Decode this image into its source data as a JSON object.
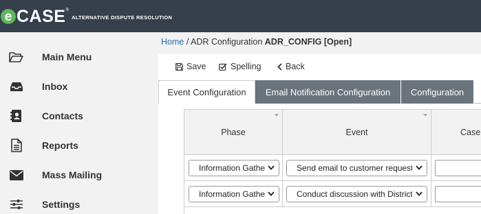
{
  "brand": {
    "logo_e": "e",
    "logo_case": "CASE",
    "logo_reg": "®",
    "tagline": "ALTERNATIVE DISPUTE RESOLUTION"
  },
  "sidebar": {
    "items": [
      {
        "label": "Main Menu",
        "icon": "folder-open-icon"
      },
      {
        "label": "Inbox",
        "icon": "inbox-icon"
      },
      {
        "label": "Contacts",
        "icon": "address-book-icon"
      },
      {
        "label": "Reports",
        "icon": "document-icon"
      },
      {
        "label": "Mass Mailing",
        "icon": "envelope-icon"
      },
      {
        "label": "Settings",
        "icon": "sliders-icon"
      }
    ]
  },
  "breadcrumb": {
    "home": "Home",
    "separator": " / ",
    "current": "ADR Configuration",
    "record": "ADR_CONFIG [Open]"
  },
  "toolbar": {
    "save": "Save",
    "spelling": "Spelling",
    "back": "Back"
  },
  "tabs": [
    {
      "label": "Event Configuration",
      "active": true
    },
    {
      "label": "Email Notification Configuration",
      "active": false
    },
    {
      "label": "Configuration",
      "active": false
    }
  ],
  "grid": {
    "columns": [
      "Phase",
      "Event",
      "Case"
    ],
    "rows": [
      {
        "phase": "Information Gathering",
        "event": "Send email to customer requesting information",
        "case": ""
      },
      {
        "phase": "Information Gathering",
        "event": "Conduct discussion with District",
        "case": ""
      }
    ]
  }
}
